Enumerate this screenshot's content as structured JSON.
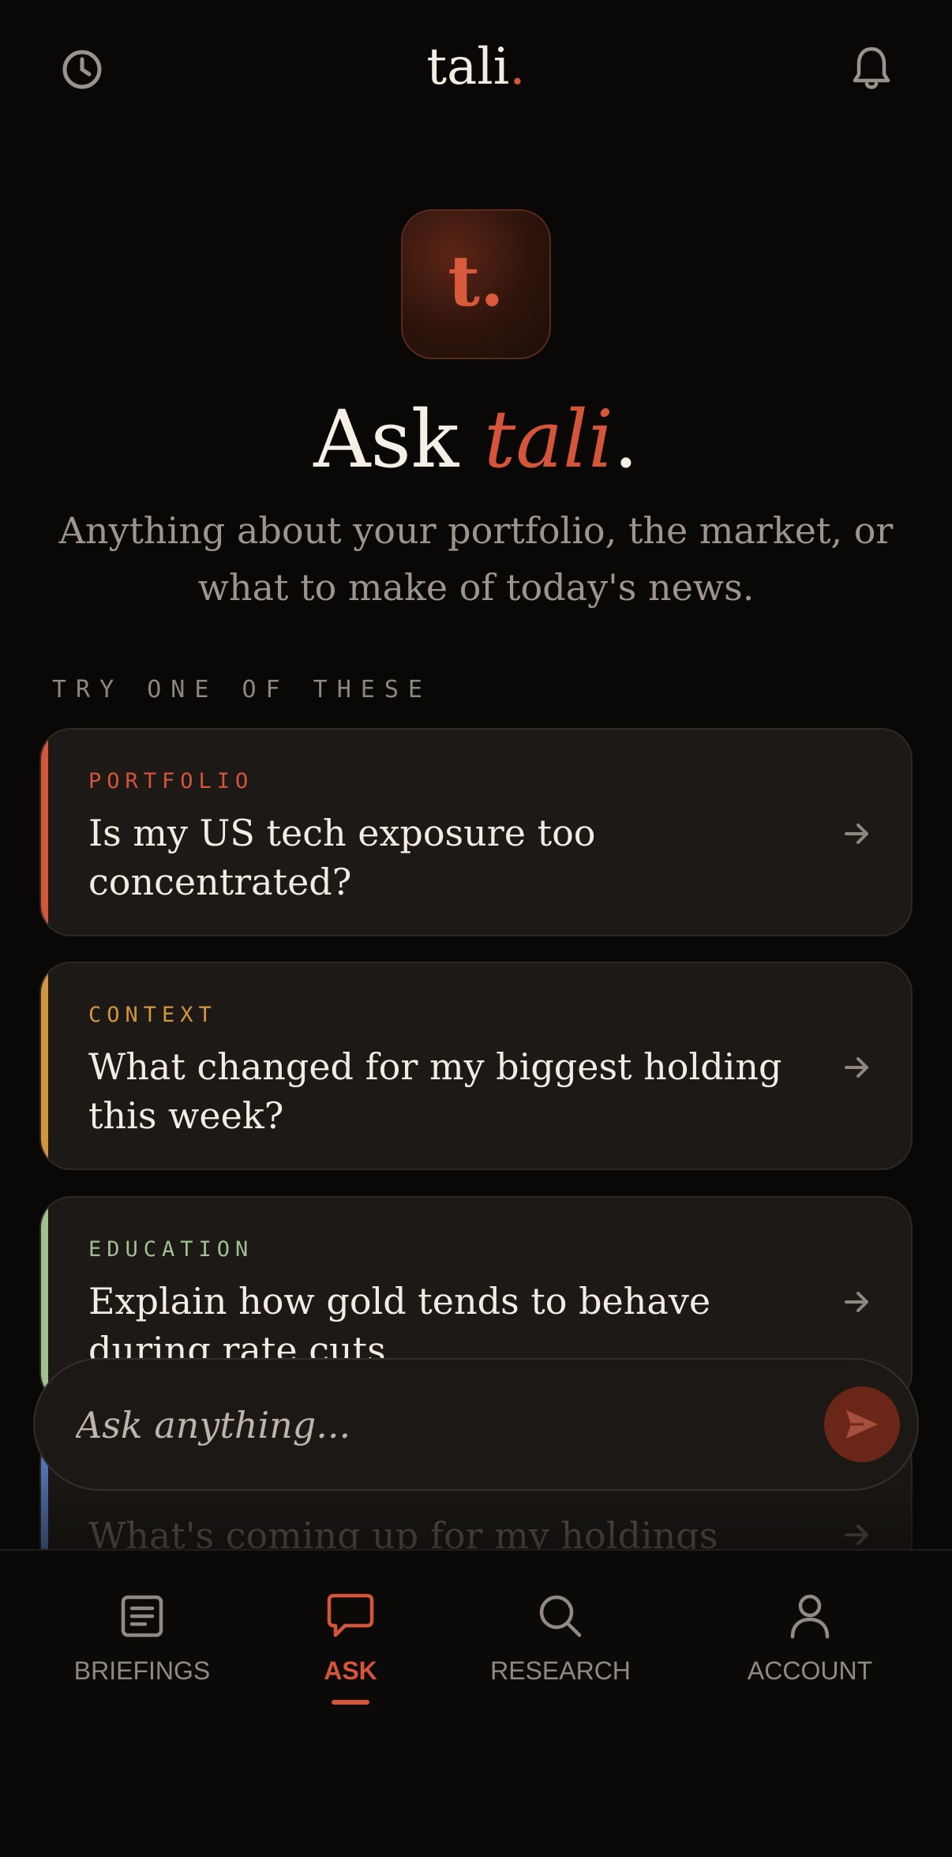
{
  "header": {
    "brand": "tali",
    "brand_dot": ".",
    "history_icon": "clock-icon",
    "notifications_icon": "bell-icon"
  },
  "hero": {
    "logo_letter": "t.",
    "title_prefix": "Ask ",
    "title_accent": "tali",
    "title_suffix": ".",
    "subtitle": "Anything about your portfolio, the market, or what to make of today's news."
  },
  "suggestions": {
    "label": "TRY ONE OF THESE",
    "items": [
      {
        "tag": "PORTFOLIO",
        "question": "Is my US tech exposure too concentrated?",
        "color": "#d4553a"
      },
      {
        "tag": "CONTEXT",
        "question": "What changed for my biggest holding this week?",
        "color": "#d3963e"
      },
      {
        "tag": "EDUCATION",
        "question": "Explain how gold tends to behave during rate cuts.",
        "color": "#9fc08f"
      },
      {
        "tag": "",
        "question": "What's coming up for my holdings",
        "color": "#5b82c6"
      }
    ]
  },
  "ask": {
    "placeholder": "Ask anything..."
  },
  "nav": {
    "items": [
      {
        "label": "BRIEFINGS",
        "icon": "newspaper-icon"
      },
      {
        "label": "ASK",
        "icon": "chat-bubble-icon",
        "active": true
      },
      {
        "label": "RESEARCH",
        "icon": "search-icon"
      },
      {
        "label": "ACCOUNT",
        "icon": "user-icon"
      }
    ]
  },
  "colors": {
    "accent": "#d4553a",
    "background": "#090807",
    "card": "#1d1916"
  }
}
